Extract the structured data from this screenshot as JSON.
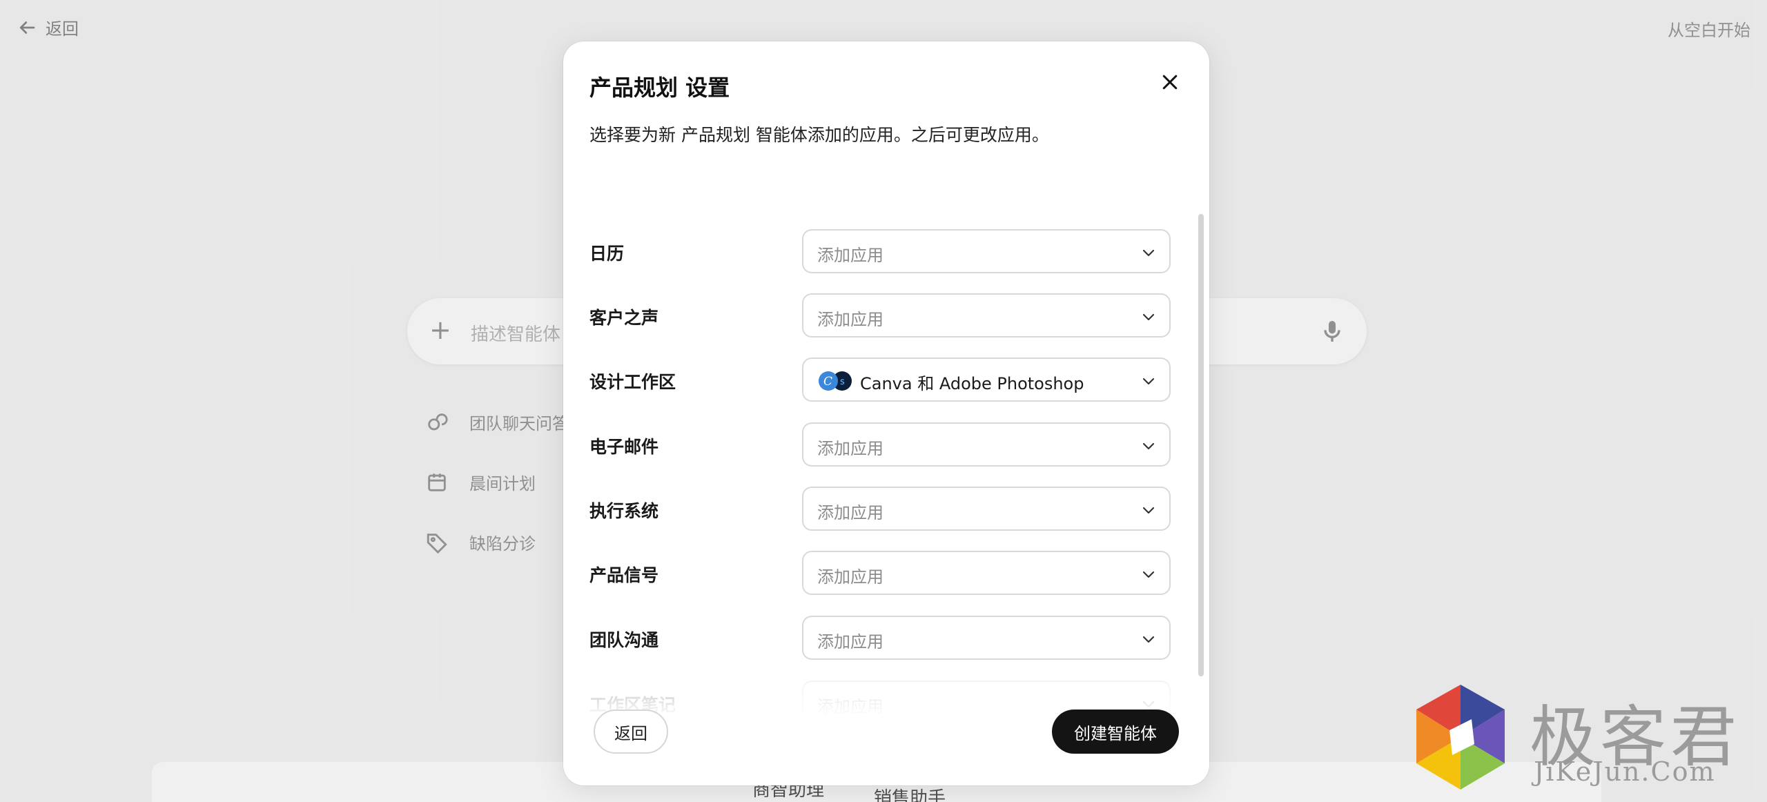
{
  "background": {
    "back_label": "返回",
    "start_blank_label": "从空白开始",
    "input_placeholder": "描述智能体",
    "suggestions": [
      {
        "label": "团队聊天问答",
        "icon": "chat-icon"
      },
      {
        "label": "晨间计划",
        "icon": "calendar-icon"
      },
      {
        "label": "缺陷分诊",
        "icon": "tag-icon"
      }
    ],
    "bottom_cards": [
      "商智助理",
      "销售助手"
    ]
  },
  "modal": {
    "title": "产品规划 设置",
    "description": "选择要为新 产品规划 智能体添加的应用。之后可更改应用。",
    "rows": [
      {
        "label": "日历",
        "value": "添加应用",
        "filled": false
      },
      {
        "label": "客户之声",
        "value": "添加应用",
        "filled": false
      },
      {
        "label": "设计工作区",
        "value": "Canva 和 Adobe Photoshop",
        "filled": true,
        "icons": [
          "canva-icon",
          "photoshop-icon"
        ]
      },
      {
        "label": "电子邮件",
        "value": "添加应用",
        "filled": false
      },
      {
        "label": "执行系统",
        "value": "添加应用",
        "filled": false
      },
      {
        "label": "产品信号",
        "value": "添加应用",
        "filled": false
      },
      {
        "label": "团队沟通",
        "value": "添加应用",
        "filled": false
      },
      {
        "label": "工作区笔记",
        "value": "添加应用",
        "filled": false
      }
    ],
    "back_button": "返回",
    "create_button": "创建智能体"
  },
  "watermark": {
    "brand": "极客君",
    "domain": "JiKeJun.Com"
  },
  "colors": {
    "primary_button": "#141414",
    "border": "#d9d9d9",
    "placeholder": "#8c8c8c",
    "watermark": "#9b9b9b"
  }
}
